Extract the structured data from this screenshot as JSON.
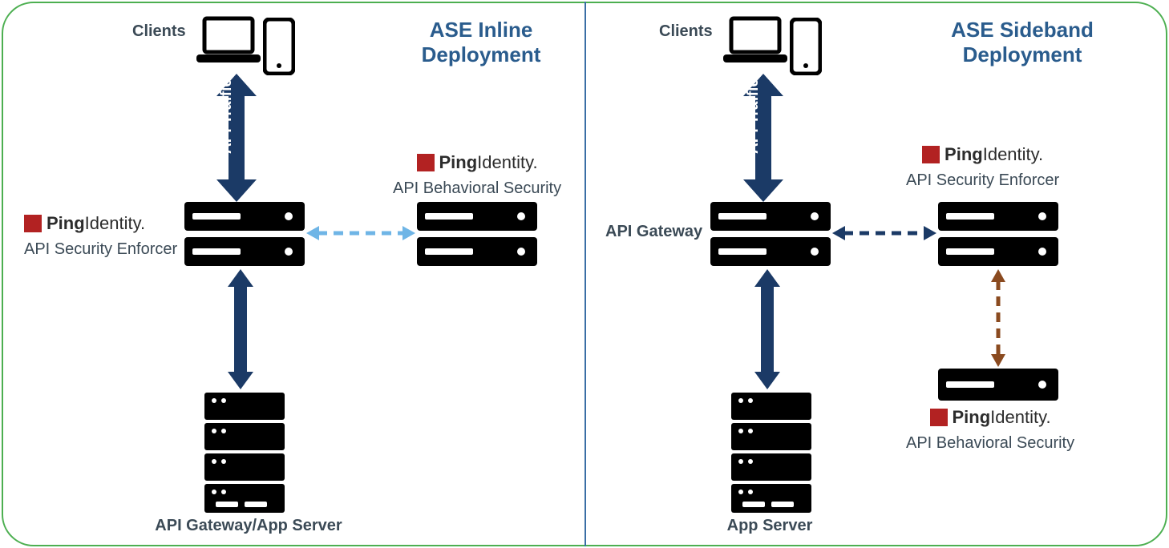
{
  "left": {
    "heading_line1": "ASE Inline",
    "heading_line2": "Deployment",
    "clients_label": "Clients",
    "api_traffic": "API Traffic",
    "ping_brand": "PingIdentity.",
    "enforcer_label": "API Security Enforcer",
    "behavioral_label": "API Behavioral Security",
    "bottom_label": "API Gateway/App Server"
  },
  "right": {
    "heading_line1": "ASE Sideband",
    "heading_line2": "Deployment",
    "clients_label": "Clients",
    "api_traffic": "API Traffic",
    "ping_brand": "PingIdentity.",
    "gateway_label": "API Gateway",
    "enforcer_label": "API Security Enforcer",
    "behavioral_label": "API Behavioral Security",
    "bottom_label": "App Server"
  }
}
